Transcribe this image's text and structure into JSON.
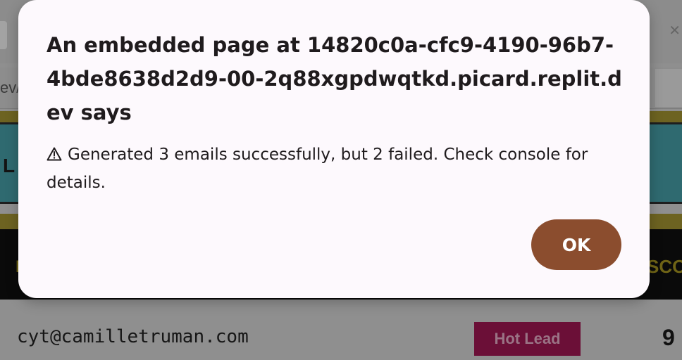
{
  "dialog": {
    "title": "An embedded page at 14820c0a-cfc9-4190-96b7-4bde8638d2d9-00-2q88xgpdwqtkd.picard.replit.dev says",
    "message_icon": "warning-triangle-icon",
    "message": "Generated 3 emails successfully, but 2 failed. Check console for details.",
    "ok_label": "OK",
    "ok_color": "#8b4d2e"
  },
  "background": {
    "url_fragment": "ev/",
    "panel_text": "L",
    "header_left": "I",
    "header_right": "SCO",
    "row": {
      "email": "cyt@camilletruman.com",
      "badge": "Hot Lead",
      "badge_color": "#6b0f37",
      "score": "9"
    }
  }
}
